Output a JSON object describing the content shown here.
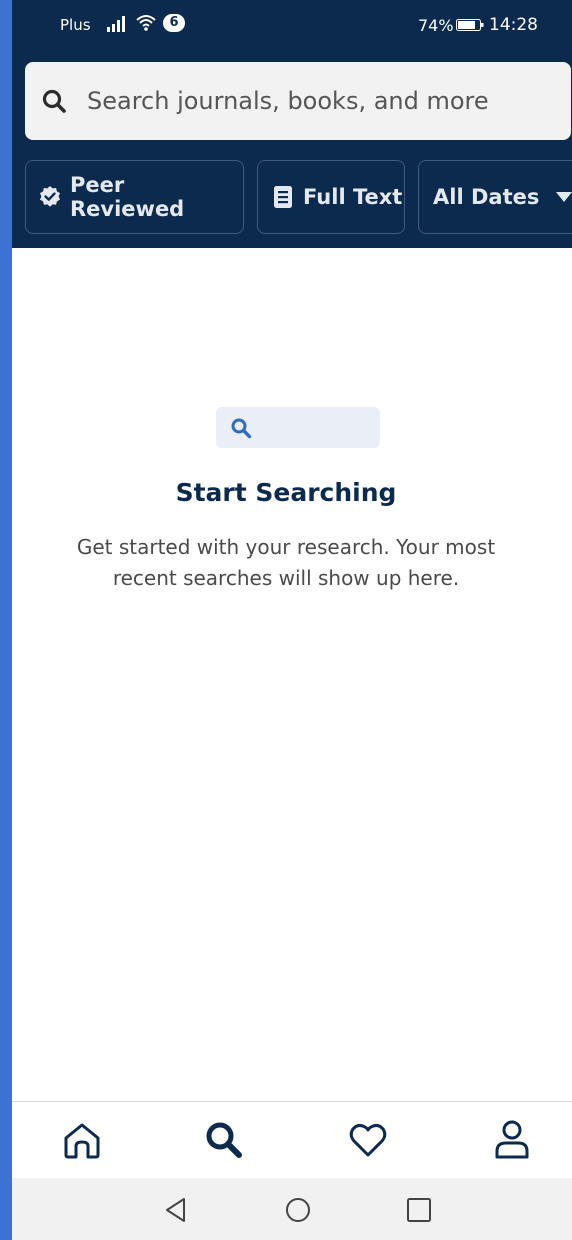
{
  "status_bar": {
    "carrier": "Plus",
    "notification_count": "6",
    "battery_percent": "74%",
    "time": "14:28"
  },
  "search": {
    "placeholder": "Search journals, books, and more",
    "value": ""
  },
  "filters": {
    "peer_reviewed": "Peer Reviewed",
    "full_text": "Full Text",
    "dates": "All Dates"
  },
  "empty_state": {
    "title": "Start Searching",
    "description": "Get started with your research. Your most recent searches will show up here."
  },
  "icons": {
    "status": [
      "signal-icon",
      "wifi-icon",
      "battery-icon"
    ],
    "search": "search-icon",
    "filters": [
      "verified-badge-icon",
      "document-icon",
      "caret-down-icon"
    ],
    "bottom_nav": [
      "home-icon",
      "search-icon",
      "heart-icon",
      "user-icon"
    ],
    "system_nav": [
      "back-icon",
      "home-circle-icon",
      "recents-icon"
    ]
  },
  "colors": {
    "header_bg": "#0b2a4d",
    "accent": "#2f6ebf",
    "empty_icon_bg": "#e9eef7",
    "outer_frame": "#3c73d3"
  }
}
